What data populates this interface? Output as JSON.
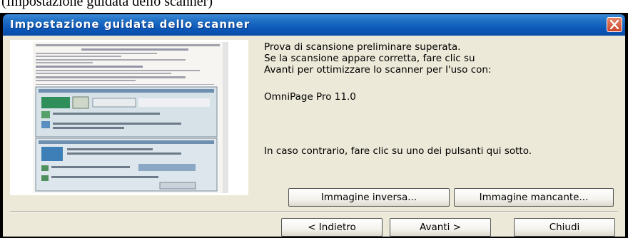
{
  "caption": "(Impostazione guidata dello scanner)",
  "window": {
    "title": "Impostazione guidata dello scanner"
  },
  "message": {
    "lines": [
      "Prova di scansione preliminare superata.",
      "Se la scansione appare corretta, fare clic su",
      "Avanti per ottimizzare lo scanner per l'uso con:"
    ],
    "product": "OmniPage Pro 11.0",
    "alternative": "In caso contrario, fare clic su uno dei pulsanti qui sotto."
  },
  "buttons": {
    "inverted_image": "Immagine inversa...",
    "missing_image": "Immagine mancante...",
    "back": "< Indietro",
    "next": "Avanti >",
    "close": "Chiudi"
  },
  "icons": {
    "close": "close-icon"
  },
  "colors": {
    "titlebar": "#0b56b8",
    "close_button": "#c9432a",
    "dialog_background": "#ece9d8"
  }
}
